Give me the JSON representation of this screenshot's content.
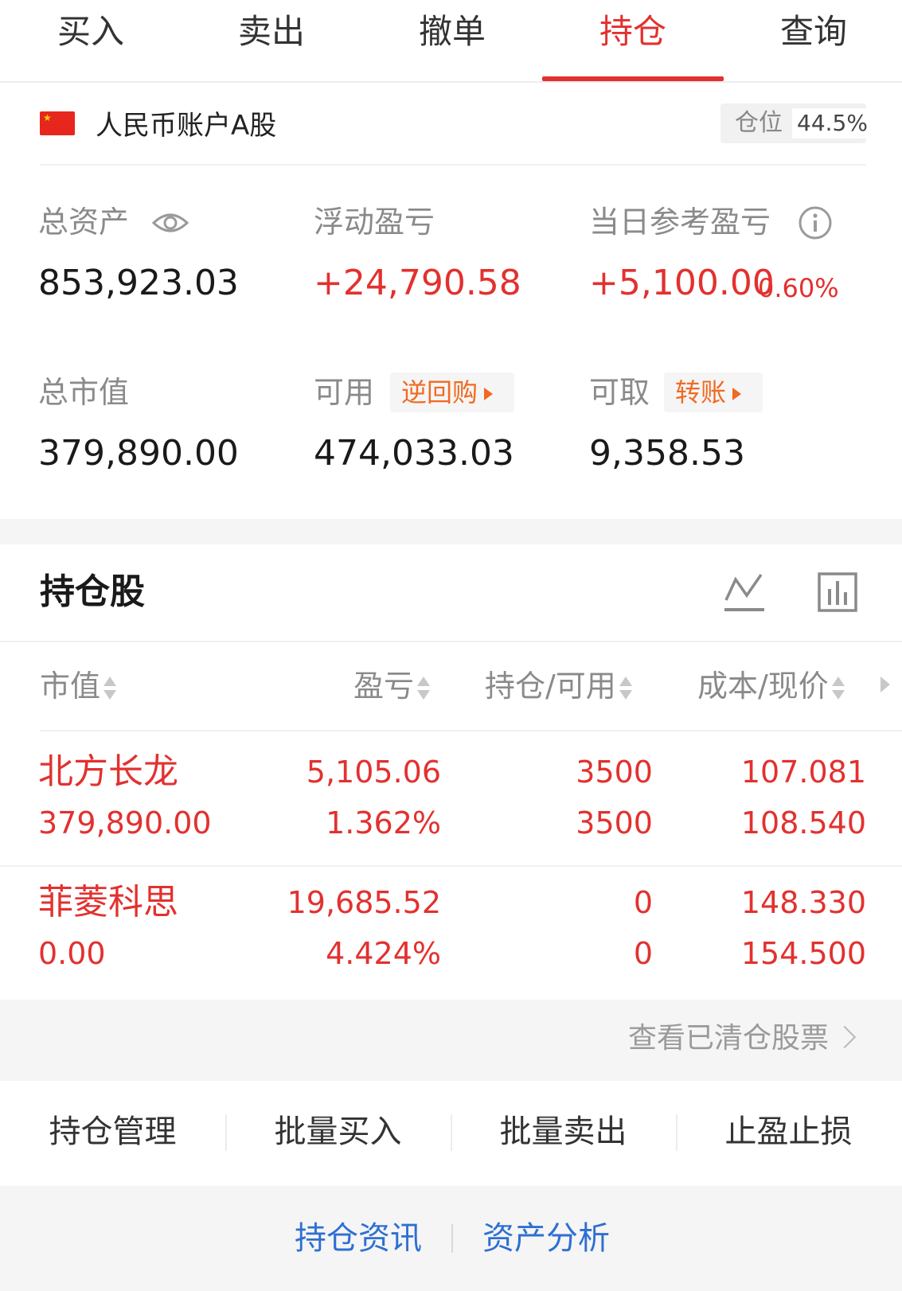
{
  "tabs": [
    "买入",
    "卖出",
    "撤单",
    "持仓",
    "查询"
  ],
  "active_tab": "持仓",
  "account": {
    "name": "人民币账户A股",
    "position_label": "仓位",
    "position_value": "44.5%"
  },
  "summary": {
    "total_assets_label": "总资产",
    "total_assets": "853,923.03",
    "floating_pnl_label": "浮动盈亏",
    "floating_pnl": "+24,790.58",
    "daily_pnl_label": "当日参考盈亏",
    "daily_pnl": "+5,100.00",
    "daily_pnl_pct": "0.60%",
    "market_value_label": "总市值",
    "market_value": "379,890.00",
    "available_label": "可用",
    "available_chip": "逆回购",
    "available": "474,033.03",
    "withdrawable_label": "可取",
    "withdrawable_chip": "转账",
    "withdrawable": "9,358.53"
  },
  "holdings_section": {
    "title": "持仓股",
    "columns": [
      "市值",
      "盈亏",
      "持仓/可用",
      "成本/现价"
    ],
    "rows": [
      {
        "name": "北方长龙",
        "market_value": "379,890.00",
        "pnl": "5,105.06",
        "pnl_pct": "1.362%",
        "holding": "3500",
        "available": "3500",
        "cost": "107.081",
        "price": "108.540"
      },
      {
        "name": "菲菱科思",
        "market_value": "0.00",
        "pnl": "19,685.52",
        "pnl_pct": "4.424%",
        "holding": "0",
        "available": "0",
        "cost": "148.330",
        "price": "154.500"
      }
    ],
    "cleared_link": "查看已清仓股票"
  },
  "actions": [
    "持仓管理",
    "批量买入",
    "批量卖出",
    "止盈止损"
  ],
  "bottom_links": [
    "持仓资讯",
    "资产分析"
  ],
  "colors": {
    "accent": "#e2312f",
    "chip": "#f06a22",
    "link": "#2f6fd2"
  },
  "icons": [
    "china-flag-icon",
    "eye-icon",
    "info-icon",
    "trend-line-icon",
    "bar-chart-icon",
    "sort-icon",
    "chevron-right-icon"
  ]
}
